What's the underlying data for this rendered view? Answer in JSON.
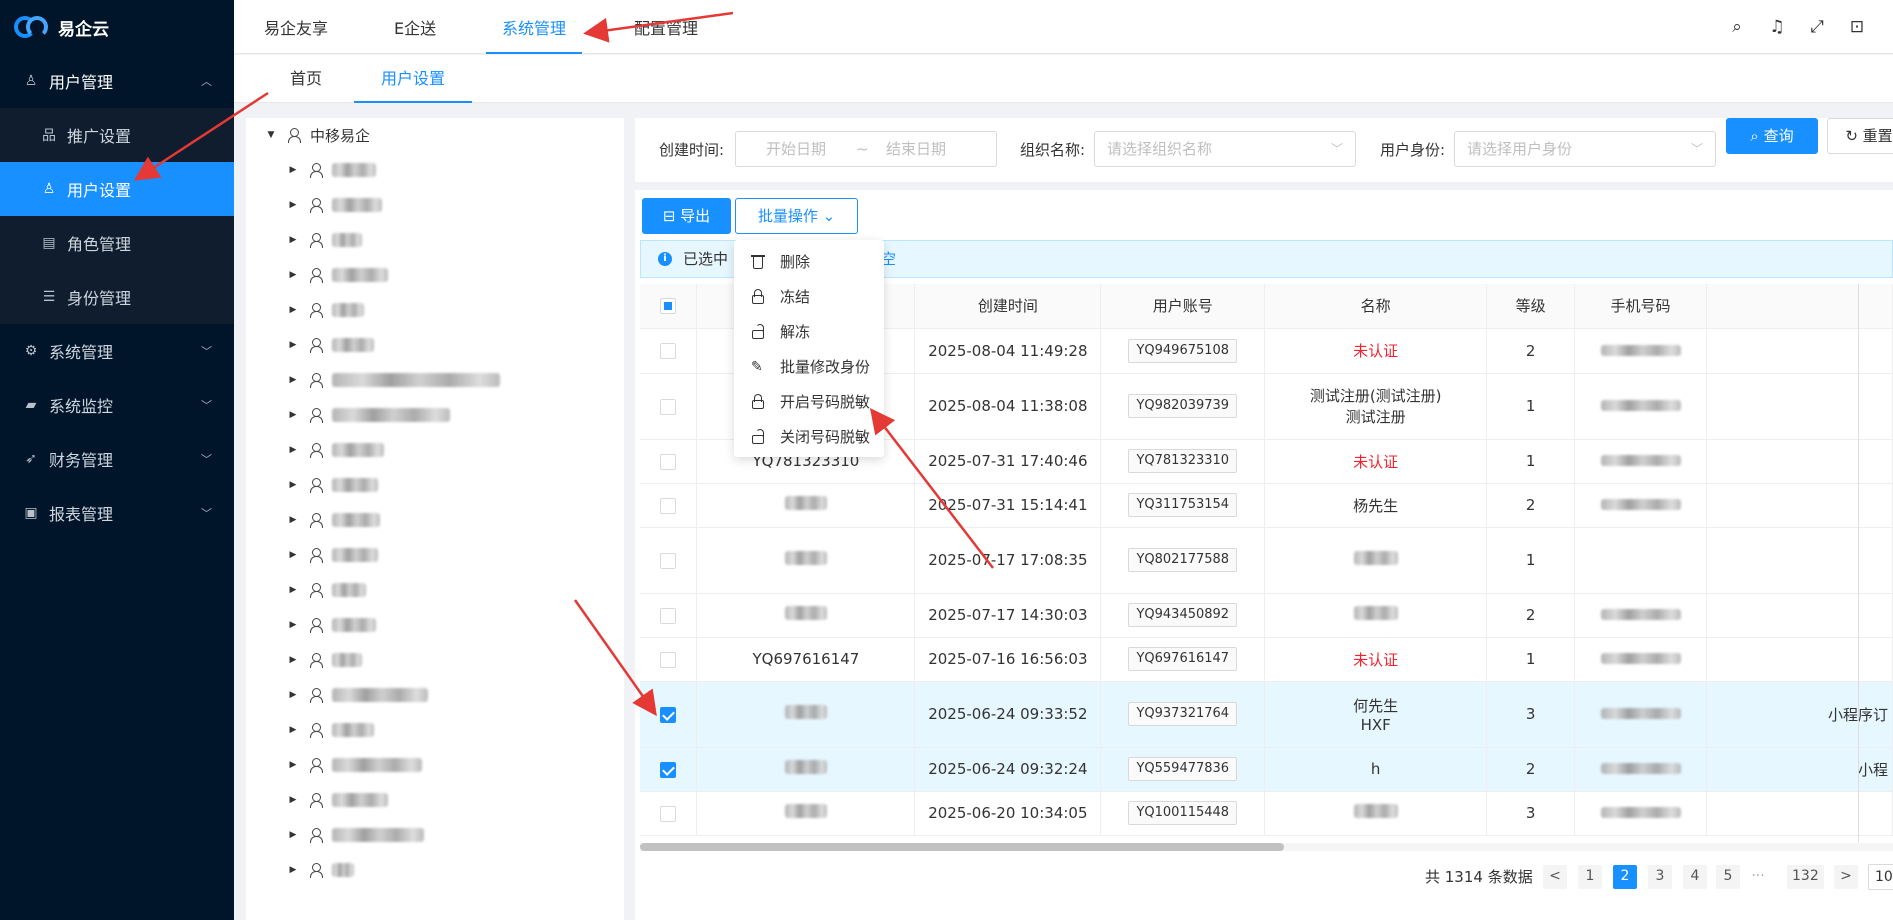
{
  "app": {
    "name": "易企云"
  },
  "sidebar": {
    "groups": [
      {
        "label": "用户管理",
        "icon": "user-icon",
        "expanded": true,
        "items": [
          {
            "label": "推广设置",
            "icon": "org-chart-icon"
          },
          {
            "label": "用户设置",
            "icon": "user-icon",
            "active": true
          },
          {
            "label": "角色管理",
            "icon": "document-icon"
          },
          {
            "label": "身份管理",
            "icon": "list-icon"
          }
        ]
      },
      {
        "label": "系统管理",
        "icon": "gear-icon"
      },
      {
        "label": "系统监控",
        "icon": "video-icon"
      },
      {
        "label": "财务管理",
        "icon": "rocket-icon"
      },
      {
        "label": "报表管理",
        "icon": "report-icon"
      }
    ]
  },
  "header": {
    "tabs": [
      "易企友享",
      "E企送",
      "系统管理",
      "配置管理"
    ],
    "active_tab": "系统管理",
    "icons": [
      "search-icon",
      "bell-icon",
      "fullscreen-icon",
      "lock-icon"
    ]
  },
  "subnav": {
    "tabs": [
      "首页",
      "用户设置"
    ],
    "active": "用户设置"
  },
  "tree": {
    "root": "中移易企",
    "child_count": 21
  },
  "search": {
    "created_label": "创建时间:",
    "start_placeholder": "开始日期",
    "range_sep": "~",
    "end_placeholder": "结束日期",
    "org_label": "组织名称:",
    "org_placeholder": "请选择组织名称",
    "role_label": "用户身份:",
    "role_placeholder": "请选择用户身份",
    "query_button": "查询",
    "reset_button": "重置"
  },
  "toolbar": {
    "export_button": "导出",
    "batch_button": "批量操作"
  },
  "alert": {
    "selected_text": "已选中",
    "clear_text": "空"
  },
  "dropdown": {
    "items": [
      {
        "label": "删除",
        "icon": "trash-icon"
      },
      {
        "label": "冻结",
        "icon": "lock-icon"
      },
      {
        "label": "解冻",
        "icon": "unlock-icon"
      },
      {
        "label": "批量修改身份",
        "icon": "pen-icon"
      },
      {
        "label": "开启号码脱敏",
        "icon": "lock-icon"
      },
      {
        "label": "关闭号码脱敏",
        "icon": "unlock-icon"
      }
    ]
  },
  "table": {
    "headers": [
      "",
      "",
      "创建时间",
      "用户账号",
      "名称",
      "等级",
      "手机号码",
      ""
    ],
    "rows": [
      {
        "checked": false,
        "user": "",
        "created": "2025-08-04 11:49:28",
        "account": "YQ949675108",
        "name": "未认证",
        "name_red": true,
        "level": "2",
        "extra": ""
      },
      {
        "checked": false,
        "user": "",
        "created": "2025-08-04 11:38:08",
        "account": "YQ982039739",
        "name": "测试注册(测试注册)",
        "name2": "测试注册",
        "level": "1",
        "extra": ""
      },
      {
        "checked": false,
        "user": "YQ781323310",
        "created": "2025-07-31 17:40:46",
        "account": "YQ781323310",
        "name": "未认证",
        "name_red": true,
        "level": "1",
        "extra": ""
      },
      {
        "checked": false,
        "user": "",
        "created": "2025-07-31 15:14:41",
        "account": "YQ311753154",
        "name": "杨先生",
        "level": "2",
        "extra": ""
      },
      {
        "checked": false,
        "user": "",
        "created": "2025-07-17 17:08:35",
        "account": "YQ802177588",
        "name": "",
        "level": "1",
        "extra": ""
      },
      {
        "checked": false,
        "user": "",
        "created": "2025-07-17 14:30:03",
        "account": "YQ943450892",
        "name": "",
        "level": "2",
        "extra": ""
      },
      {
        "checked": false,
        "user": "YQ697616147",
        "created": "2025-07-16 16:56:03",
        "account": "YQ697616147",
        "name": "未认证",
        "name_red": true,
        "level": "1",
        "extra": ""
      },
      {
        "checked": true,
        "user": "",
        "created": "2025-06-24 09:33:52",
        "account": "YQ937321764",
        "name": "何先生",
        "name2": "HXF",
        "level": "3",
        "extra": "小程序订"
      },
      {
        "checked": true,
        "user": "",
        "created": "2025-06-24 09:32:24",
        "account": "YQ559477836",
        "name": "h",
        "level": "2",
        "extra": "小程"
      },
      {
        "checked": false,
        "user": "",
        "created": "2025-06-20 10:34:05",
        "account": "YQ100115448",
        "name": "",
        "level": "3",
        "extra": ""
      }
    ]
  },
  "pagination": {
    "total_text": "共 1314 条数据",
    "prev": "<",
    "pages": [
      "1",
      "2",
      "3",
      "4",
      "5",
      "···",
      "132"
    ],
    "active_page": "2",
    "next": ">",
    "page_size": "10"
  },
  "colors": {
    "primary": "#1890ff",
    "sidebar_bg": "#001529",
    "danger": "#f5222d",
    "annotation": "#e53935"
  }
}
